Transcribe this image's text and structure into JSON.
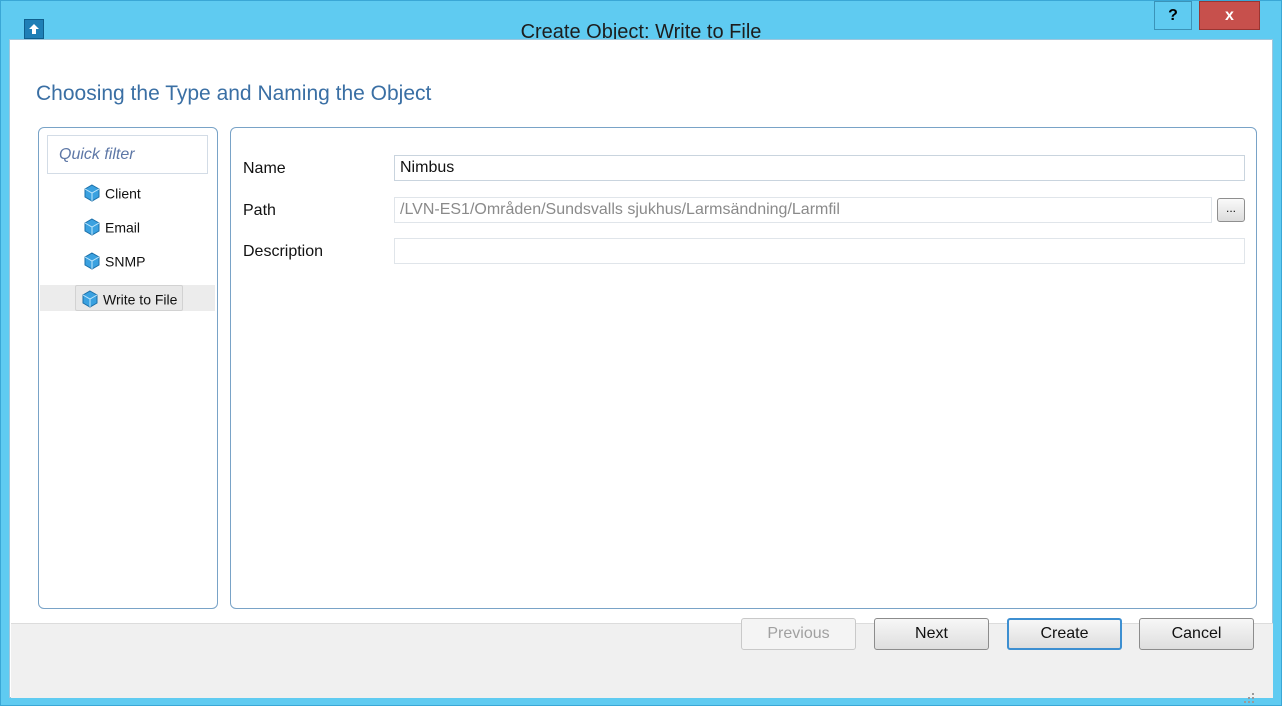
{
  "window": {
    "title": "Create Object: Write to File",
    "help_label": "?",
    "close_label": "x"
  },
  "heading": "Choosing the Type and Naming the Object",
  "filter": {
    "placeholder": "Quick filter"
  },
  "object_types": [
    {
      "label": "Client",
      "icon": "cube-icon",
      "selected": false
    },
    {
      "label": "Email",
      "icon": "cube-icon",
      "selected": false
    },
    {
      "label": "SNMP",
      "icon": "cube-icon",
      "selected": false
    },
    {
      "label": "Write to File",
      "icon": "cube-icon",
      "selected": true
    }
  ],
  "form": {
    "name_label": "Name",
    "name_value": "Nimbus",
    "path_label": "Path",
    "path_value": "/LVN-ES1/Områden/Sundsvalls sjukhus/Larmsändning/Larmfil",
    "browse_label": "...",
    "description_label": "Description",
    "description_value": ""
  },
  "buttons": {
    "previous": "Previous",
    "next": "Next",
    "create": "Create",
    "cancel": "Cancel"
  },
  "colors": {
    "title_bar": "#5fcbf1",
    "close_button": "#c7504c",
    "heading": "#3a6fa4",
    "panel_border": "#79a3c7",
    "cube": "#3aa1e0"
  }
}
